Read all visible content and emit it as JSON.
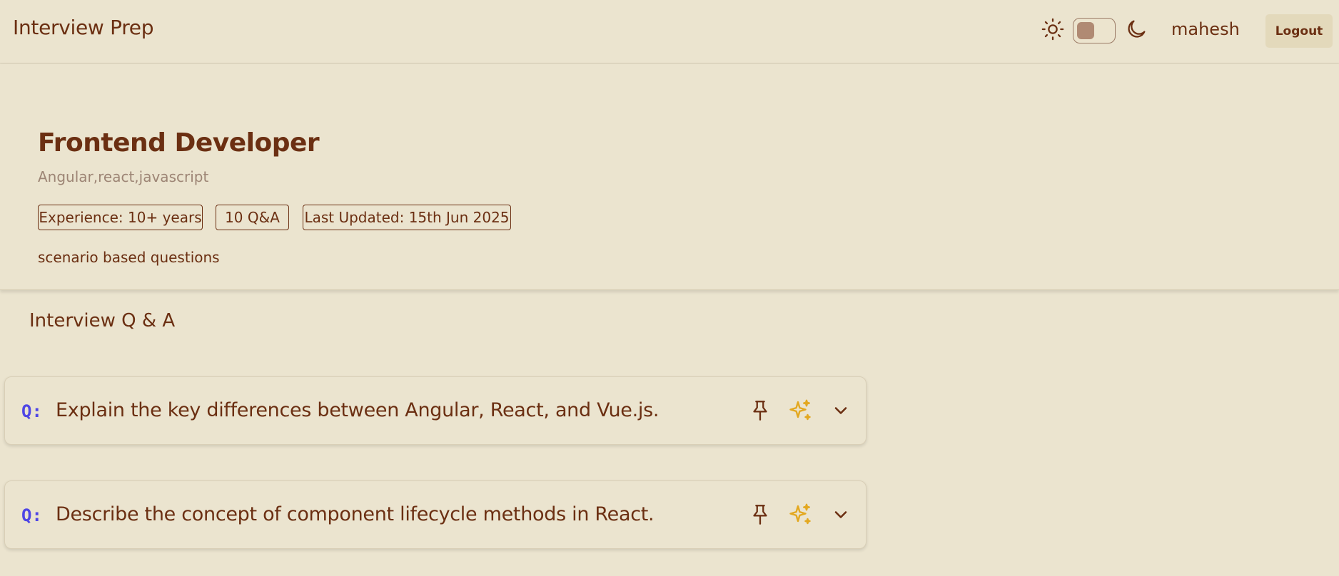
{
  "navbar": {
    "brand": "Interview Prep",
    "username": "mahesh",
    "logout_label": "Logout",
    "theme_toggle": {
      "mode": "light"
    }
  },
  "session": {
    "role": "Frontend Developer",
    "topics": "Angular,react,javascript",
    "tags": {
      "experience": "Experience: 10+ years",
      "qa_count": "10 Q&A",
      "last_updated": "Last Updated: 15th Jun 2025"
    },
    "description": "scenario based questions"
  },
  "qa_section": {
    "title": "Interview Q & A",
    "prefix": "Q:",
    "questions": [
      {
        "text": "Explain the key differences between Angular, React, and Vue.js."
      },
      {
        "text": "Describe the concept of component lifecycle methods in React."
      }
    ]
  },
  "colors": {
    "background": "#ebe4cf",
    "text_brown": "#6b2f12",
    "accent_indigo": "#4f46e5",
    "sparkle_gold": "#e3a820",
    "muted": "#9d8575"
  },
  "icons": [
    "sun-icon",
    "moon-icon",
    "pin-icon",
    "sparkle-icon",
    "chevron-down-icon"
  ]
}
